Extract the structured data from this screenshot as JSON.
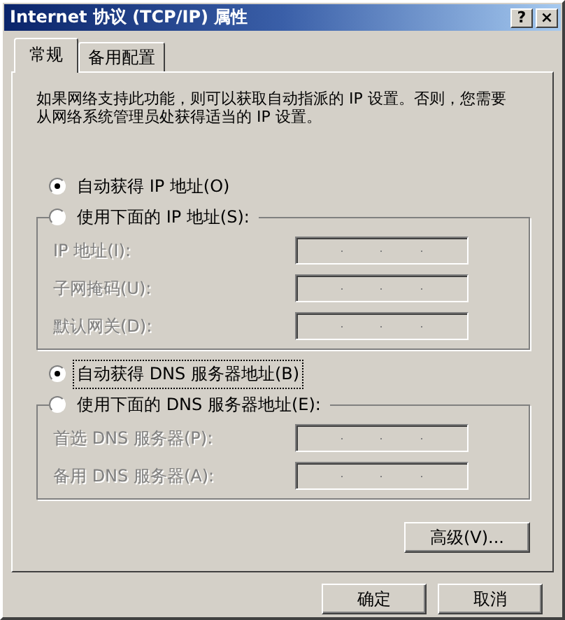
{
  "window": {
    "title": "Internet 协议 (TCP/IP) 属性",
    "buttons": [
      "?",
      "×"
    ]
  },
  "tabs": [
    {
      "label": "常规",
      "selected": true
    },
    {
      "label": "备用配置",
      "selected": false
    }
  ],
  "description": "如果网络支持此功能，则可以获取自动指派的 IP 设置。否则，您需要从网络系统管理员处获得适当的 IP 设置。",
  "sections": [
    {
      "auto": {
        "label": "自动获得 IP 地址(O)",
        "selected": true,
        "focused": false
      },
      "manual": {
        "label": "使用下面的 IP 地址(S):",
        "selected": false
      },
      "disabled": true,
      "fields": [
        {
          "label": "IP 地址(I):"
        },
        {
          "label": "子网掩码(U):"
        },
        {
          "label": "默认网关(D):"
        }
      ]
    },
    {
      "auto": {
        "label": "自动获得 DNS 服务器地址(B)",
        "selected": true,
        "focused": true
      },
      "manual": {
        "label": "使用下面的 DNS 服务器地址(E):",
        "selected": false
      },
      "disabled": true,
      "fields": [
        {
          "label": "首选 DNS 服务器(P):"
        },
        {
          "label": "备用 DNS 服务器(A):"
        }
      ]
    }
  ],
  "advanced_button": "高级(V)...",
  "dialog_buttons": [
    "确定",
    "取消"
  ]
}
